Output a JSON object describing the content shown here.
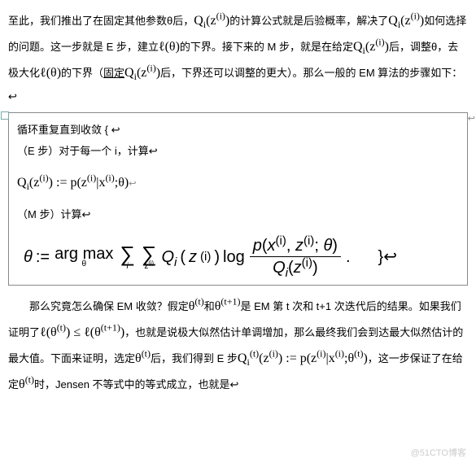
{
  "p1": "至此，我们推出了在固定其他参数θ后，",
  "p1b": "的计算公式就是后验概率，解决了",
  "p1c": "如何选择的问题。这一步就是 E 步，建立",
  "p1d": "的下界。接下来的 M 步，就是在给定",
  "p1e": "后，调整θ，去极大化",
  "p1f": "的下界（",
  "p1g_u": "固定",
  "p1h": "后，下界还可以调整的更大）。那么一般的 EM 算法的步骤如下：  ↩",
  "box": {
    "line1": "循环重复直到收敛  { ↩",
    "line2a": "（E 步）对于每一个 i，计算↩",
    "line3a": "（M 步）计算↩",
    "closebrace": "}↩"
  },
  "f_Qi": "Q",
  "f_i": "i",
  "f_z": "z",
  "f_assign": ":=",
  "f_p": "p",
  "f_x": "x",
  "f_theta": "θ",
  "f_argmax": "arg max",
  "f_log": "log",
  "f_dot": ".",
  "f_ell": "ℓ",
  "f_paren_i": "(i)",
  "f_bar": "|",
  "f_semi": ";",
  "p2a": "那么究竟怎么确保 EM 收敛？假定",
  "p2b": "和",
  "p2c": "是 EM 第 t 次和 t+1 次迭代后的结果。如果我们证明了",
  "p2d": "，也就是说极大似然估计单调增加，那么最终我们会到达最大似然估计的最大值。下面来证明，选定",
  "p2e": "后，我们得到 E 步",
  "p2f": "，这一步保证了在给定",
  "p2g": "时，Jensen 不等式中的等式成立，也就是↩",
  "sup_t": "(t)",
  "sup_t1": "(t+1)",
  "leq": "≤",
  "watermark": "@51CTO博客"
}
